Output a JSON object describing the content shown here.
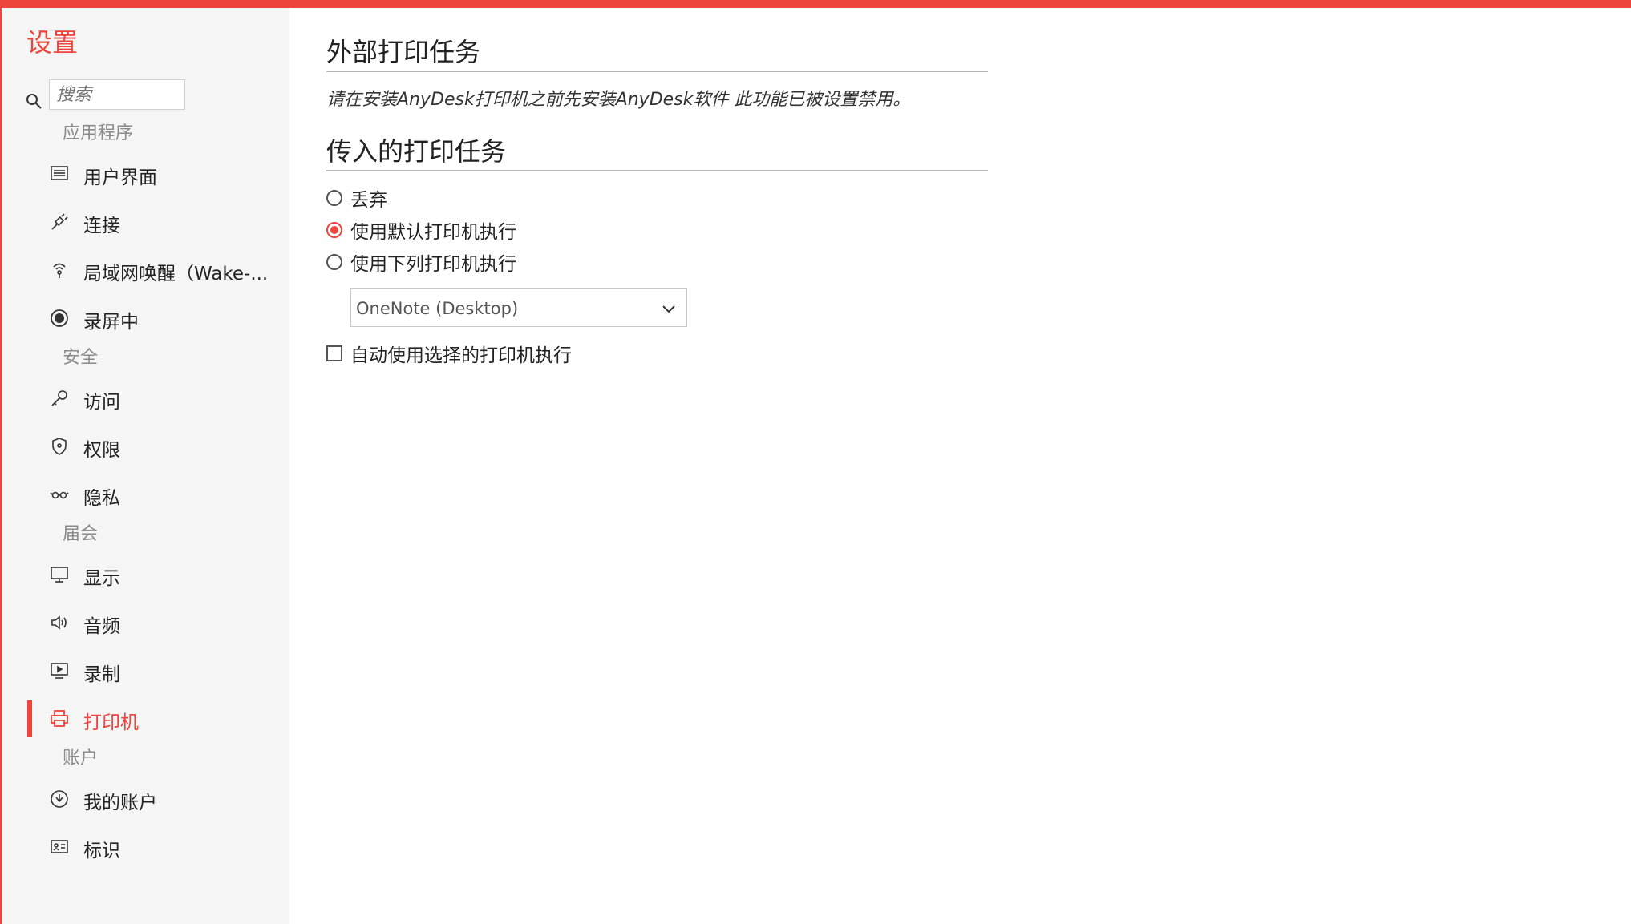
{
  "colors": {
    "accent": "#ef443b"
  },
  "sidebar": {
    "title": "设置",
    "search_placeholder": "搜索",
    "sections": {
      "app": "应用程序",
      "security": "安全",
      "session": "届会",
      "account": "账户"
    },
    "items": {
      "ui": {
        "label": "用户界面",
        "icon": "monitor-list-icon"
      },
      "connection": {
        "label": "连接",
        "icon": "plug-icon"
      },
      "wol": {
        "label": "局域网唤醒（Wake-...",
        "icon": "wake-signal-icon"
      },
      "recording": {
        "label": "录屏中",
        "icon": "record-icon"
      },
      "access": {
        "label": "访问",
        "icon": "key-icon"
      },
      "permissions": {
        "label": "权限",
        "icon": "shield-icon"
      },
      "privacy": {
        "label": "隐私",
        "icon": "glasses-icon"
      },
      "display": {
        "label": "显示",
        "icon": "display-icon"
      },
      "audio": {
        "label": "音频",
        "icon": "speaker-icon"
      },
      "record": {
        "label": "录制",
        "icon": "play-screen-icon"
      },
      "printer": {
        "label": "打印机",
        "icon": "printer-icon",
        "active": true
      },
      "my_account": {
        "label": "我的账户",
        "icon": "account-icon"
      },
      "identity": {
        "label": "标识",
        "icon": "id-card-icon"
      }
    }
  },
  "main": {
    "external_title": "外部打印任务",
    "external_note": "请在安装AnyDesk打印机之前先安装AnyDesk软件 此功能已被设置禁用。",
    "incoming_title": "传入的打印任务",
    "options": {
      "discard": "丢弃",
      "default_printer": "使用默认打印机执行",
      "following_printer": "使用下列打印机执行"
    },
    "selected_option": "default_printer",
    "printer_select_value": "OneNote (Desktop)",
    "auto_use_label": "自动使用选择的打印机执行",
    "auto_use_checked": false
  }
}
